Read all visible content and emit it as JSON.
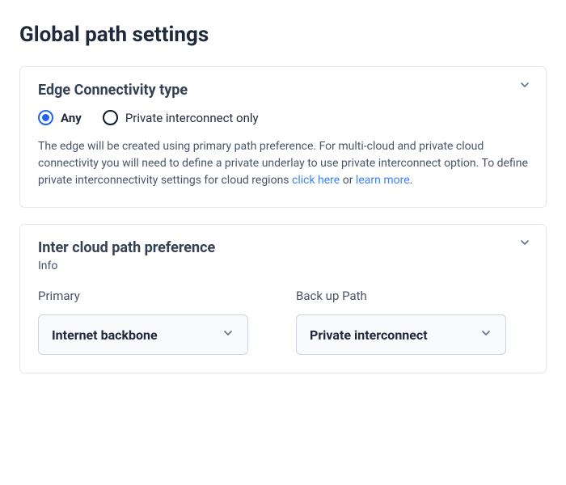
{
  "page_title": "Global path settings",
  "edge_connectivity": {
    "title": "Edge Connectivity type",
    "options": {
      "any": "Any",
      "private": "Private interconnect only"
    },
    "selected": "any",
    "description_parts": {
      "p1": "The edge will be created using primary path preference. For multi-cloud and private cloud connectivity you will need to define a private underlay to use private interconnect option. To define private interconnectivity settings for cloud regions ",
      "link1": "click here",
      "p2": " or ",
      "link2": "learn more",
      "p3": "."
    }
  },
  "intercloud": {
    "title": "Inter cloud path preference",
    "subtext": "Info",
    "primary": {
      "label": "Primary",
      "value": "Internet backbone"
    },
    "backup": {
      "label": "Back up Path",
      "value": "Private interconnect"
    }
  }
}
